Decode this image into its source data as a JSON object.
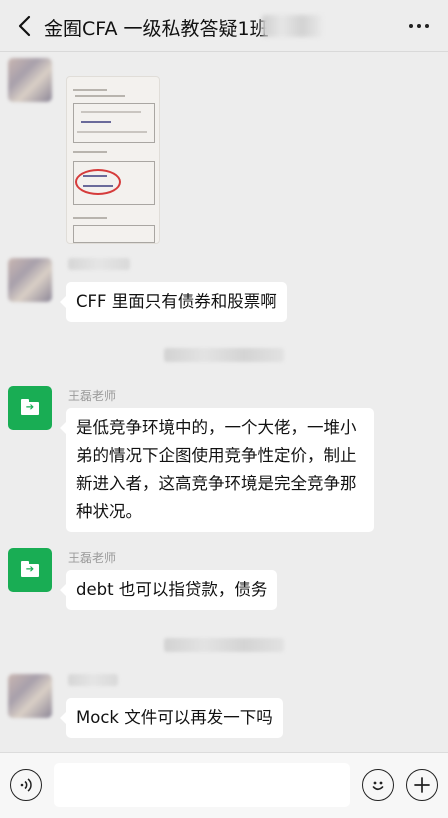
{
  "header": {
    "title": "金囿CFA 一级私教答疑1班",
    "back_icon": "chevron-left-icon",
    "more_icon": "more-horizontal-icon"
  },
  "messages": [
    {
      "type": "image",
      "sender": "",
      "avatar": "blurred-avatar"
    },
    {
      "type": "text",
      "sender": "",
      "avatar": "blurred-avatar",
      "text": "CFF 里面只有债券和股票啊"
    },
    {
      "type": "text",
      "sender": "王磊老师",
      "avatar": "folder-share-icon",
      "text": "是低竞争环境中的，一个大佬，一堆小弟的情况下企图使用竞争性定价，制止新进入者，这高竞争环境是完全竞争那种状况。"
    },
    {
      "type": "text",
      "sender": "王磊老师",
      "avatar": "folder-share-icon",
      "text": "debt 也可以指贷款，债务"
    },
    {
      "type": "text",
      "sender": "",
      "avatar": "blurred-avatar",
      "text": "Mock 文件可以再发一下吗"
    }
  ],
  "input_bar": {
    "message_value": "",
    "voice_icon": "voice-icon",
    "emoji_icon": "emoji-icon",
    "plus_icon": "plus-icon"
  },
  "colors": {
    "background": "#ededed",
    "bubble": "#ffffff",
    "teacher_avatar": "#19ad54",
    "annotation_circle": "#d53b3b"
  }
}
